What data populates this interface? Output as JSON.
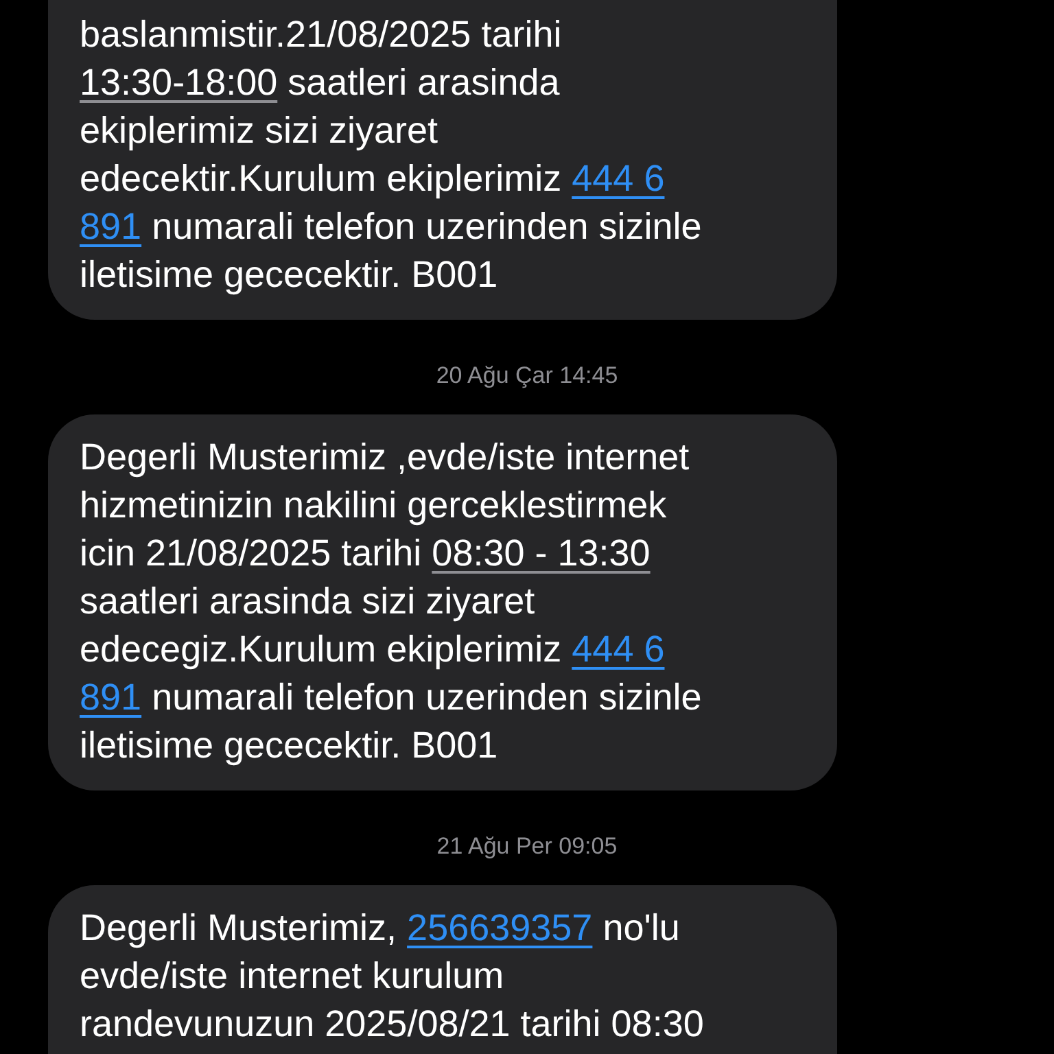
{
  "messages": [
    {
      "kind": "message",
      "lines": [
        [
          {
            "kind": "text",
            "text": "baslanmistir.21/08/2025 tarihi"
          }
        ],
        [
          {
            "kind": "date",
            "text": "13:30-18:00"
          },
          {
            "kind": "text",
            "text": " saatleri arasinda"
          }
        ],
        [
          {
            "kind": "text",
            "text": "ekiplerimiz sizi ziyaret"
          }
        ],
        [
          {
            "kind": "text",
            "text": "edecektir.Kurulum ekiplerimiz "
          },
          {
            "kind": "link",
            "text": "444 6"
          }
        ],
        [
          {
            "kind": "link",
            "text": "891"
          },
          {
            "kind": "text",
            "text": " numarali telefon uzerinden sizinle"
          }
        ],
        [
          {
            "kind": "text",
            "text": "iletisime gececektir. B001"
          }
        ]
      ]
    },
    {
      "kind": "timestamp",
      "text": "20 Ağu Çar 14:45"
    },
    {
      "kind": "message",
      "lines": [
        [
          {
            "kind": "text",
            "text": "Degerli Musterimiz ,evde/iste internet"
          }
        ],
        [
          {
            "kind": "text",
            "text": "hizmetinizin nakilini gerceklestirmek"
          }
        ],
        [
          {
            "kind": "text",
            "text": "icin 21/08/2025 tarihi "
          },
          {
            "kind": "date",
            "text": "08:30 - 13:30"
          }
        ],
        [
          {
            "kind": "text",
            "text": "saatleri arasinda sizi ziyaret"
          }
        ],
        [
          {
            "kind": "text",
            "text": "edecegiz.Kurulum ekiplerimiz "
          },
          {
            "kind": "link",
            "text": "444 6"
          }
        ],
        [
          {
            "kind": "link",
            "text": "891"
          },
          {
            "kind": "text",
            "text": " numarali telefon uzerinden sizinle"
          }
        ],
        [
          {
            "kind": "text",
            "text": "iletisime gececektir. B001"
          }
        ]
      ]
    },
    {
      "kind": "timestamp",
      "text": "21 Ağu Per 09:05"
    },
    {
      "kind": "message",
      "lines": [
        [
          {
            "kind": "text",
            "text": "Degerli Musterimiz, "
          },
          {
            "kind": "link",
            "text": "256639357"
          },
          {
            "kind": "text",
            "text": " no'lu"
          }
        ],
        [
          {
            "kind": "text",
            "text": "evde/iste internet kurulum"
          }
        ],
        [
          {
            "kind": "text",
            "text": "randevunuzun 2025/08/21 tarihi 08:30"
          }
        ]
      ]
    }
  ]
}
